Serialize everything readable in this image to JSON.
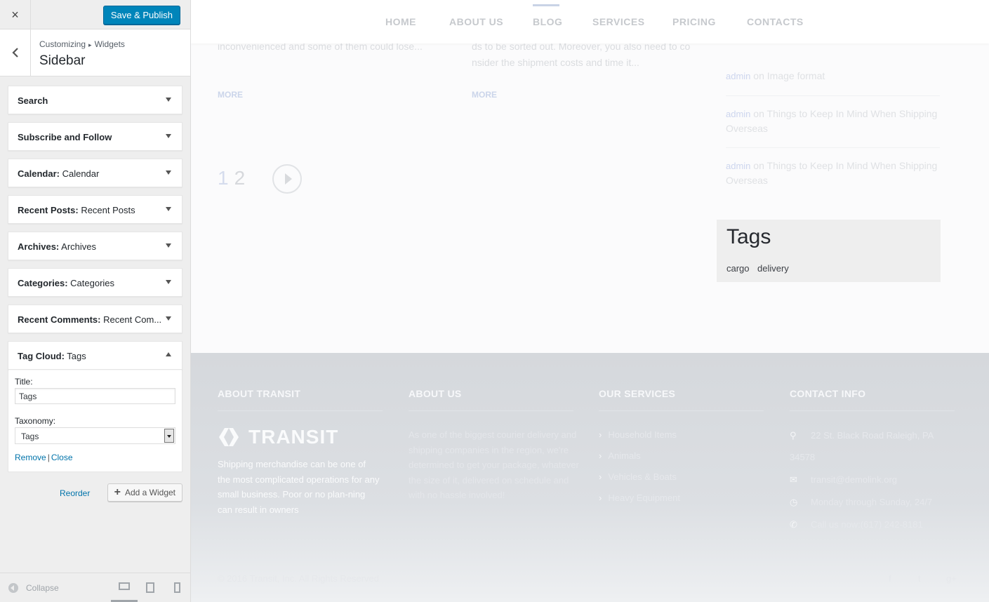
{
  "customizer": {
    "close_icon": "×",
    "save_label": "Save & Publish",
    "breadcrumb": {
      "part1": "Customizing",
      "sep": "▸",
      "part2": "Widgets"
    },
    "title": "Sidebar",
    "back_icon": "‹",
    "widgets": [
      {
        "name": "Search",
        "title": ""
      },
      {
        "name": "Subscribe and Follow",
        "title": ""
      },
      {
        "name": "Calendar:",
        "title": " Calendar"
      },
      {
        "name": "Recent Posts:",
        "title": " Recent Posts"
      },
      {
        "name": "Archives:",
        "title": " Archives"
      },
      {
        "name": "Categories:",
        "title": " Categories"
      },
      {
        "name": "Recent Comments:",
        "title": " Recent Com..."
      }
    ],
    "open_widget": {
      "name": "Tag Cloud:",
      "title": " Tags",
      "title_label": "Title:",
      "title_value": "Tags",
      "taxonomy_label": "Taxonomy:",
      "taxonomy_value": "Tags",
      "remove": "Remove",
      "sep": "|",
      "close": "Close"
    },
    "reorder": "Reorder",
    "add_widget": "Add a Widget",
    "collapse": "Collapse"
  },
  "preview": {
    "nav": [
      "HOME",
      "ABOUT US",
      "BLOG",
      "SERVICES",
      "PRICING",
      "CONTACTS"
    ],
    "post1_text": "inconvenienced and some of them could lose...",
    "post2_text_l1": "ds to be sorted out. Moreover, you also need to co",
    "post2_text_l2": "nsider the shipment costs and time it...",
    "more": "MORE",
    "pages": [
      "1",
      "2"
    ],
    "comments": [
      {
        "who": "admin",
        "on": " on ",
        "post": "Image format"
      },
      {
        "who": "admin",
        "on": " on ",
        "post": "Things to Keep In Mind When Shipping Overseas"
      },
      {
        "who": "admin",
        "on": " on ",
        "post": "Things to Keep In Mind When Shipping Overseas"
      }
    ],
    "tags_title": "Tags",
    "tags": [
      "cargo",
      "delivery"
    ],
    "footer": {
      "h_about_transit": "ABOUT TRANSIT",
      "h_about_us": "ABOUT US",
      "h_services": "OUR SERVICES",
      "h_contact": "CONTACT INFO",
      "logo_text": "TRANSIT",
      "about_transit_text": "Shipping merchandise can be one of the most complicated operations for any small business. Poor or no plan-ning can result in owners",
      "about_us_text": "As one of the biggest courier delivery and shipping companies in the region, we're determined to get your package, whatever the size of it, delivered on schedule and with no hassle involved!",
      "services": [
        "Household Items",
        "Animals",
        "Vehicles & Boats",
        "Heavy Equipment"
      ],
      "contact_address": "22 St. Black Road Raleigh, PA 34578",
      "contact_email": "transit@demolink.org",
      "contact_hours": "Monday through Sunday, 24/7",
      "contact_phone": "Call us now:(617) 242-8181",
      "copyright": "© 2016 Transit, Inc. All Rights Reserved"
    }
  }
}
